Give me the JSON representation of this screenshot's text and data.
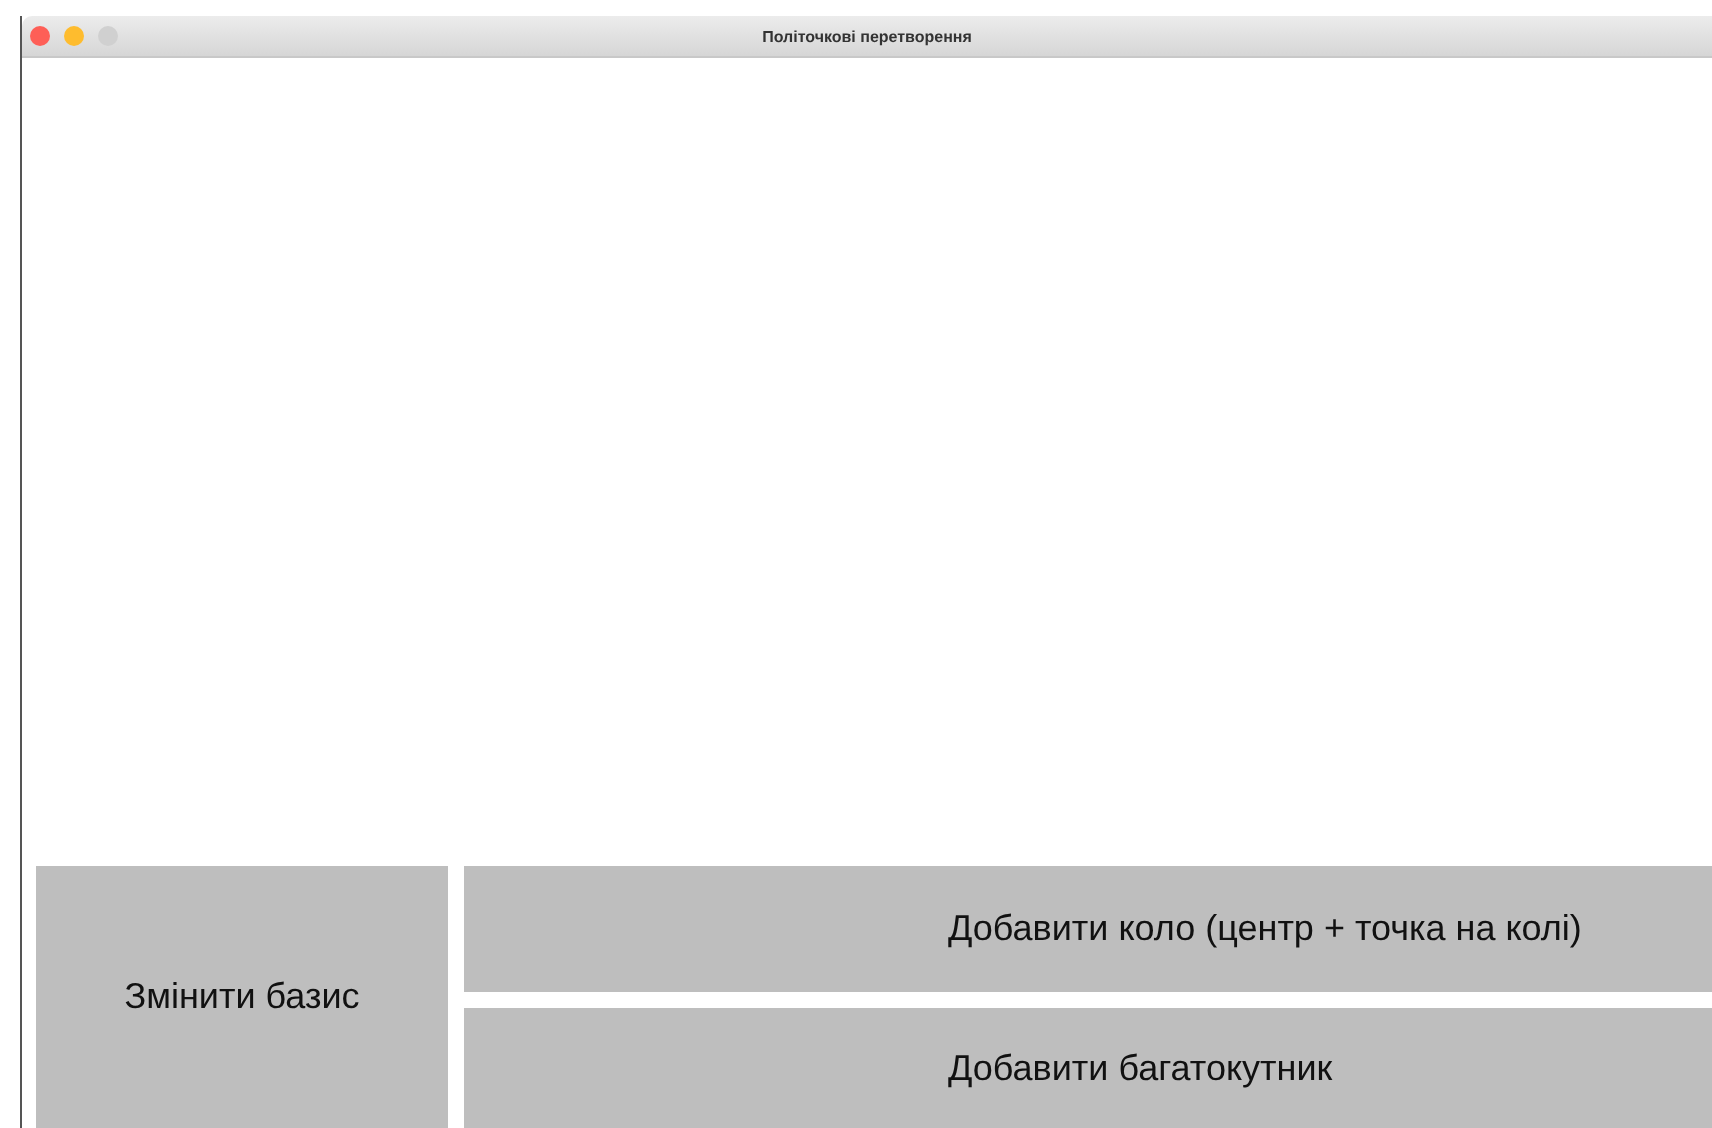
{
  "window": {
    "title": "Політочкові перетворення"
  },
  "buttons": [
    {
      "label": "Змінити базис"
    },
    {
      "label": "Добавити коло (центр + точка на колі)"
    },
    {
      "label": "Добавити багатокутник"
    }
  ]
}
